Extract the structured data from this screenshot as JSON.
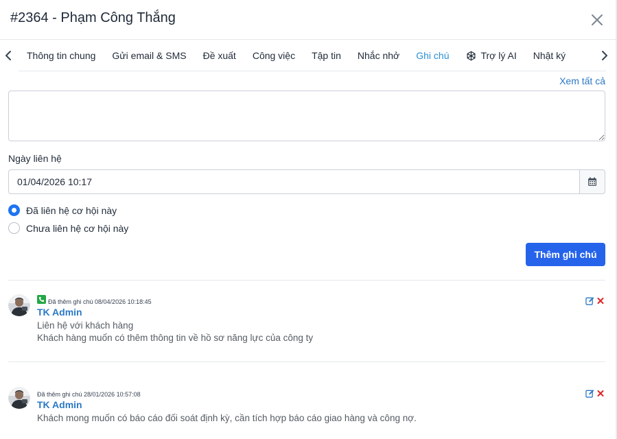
{
  "modal": {
    "title": "#2364 - Phạm Công Thắng"
  },
  "tabs": [
    {
      "label": "Thông tin chung"
    },
    {
      "label": "Gửi email & SMS"
    },
    {
      "label": "Đề xuất"
    },
    {
      "label": "Công việc"
    },
    {
      "label": "Tập tin"
    },
    {
      "label": "Nhắc nhở"
    },
    {
      "label": "Ghi chú",
      "active": true
    },
    {
      "label": "Trợ lý AI",
      "icon": "openai-icon"
    },
    {
      "label": "Nhật ký"
    }
  ],
  "notes_form": {
    "view_all": "Xem tất cả",
    "textarea_value": "",
    "contact_date_label": "Ngày liên hệ",
    "contact_date_value": "01/04/2026 10:17",
    "radio_contacted": "Đã liên hệ cơ hội này",
    "radio_not_contacted": "Chưa liên hệ cơ hội này",
    "selected_radio": "contacted",
    "submit_label": "Thêm ghi chú"
  },
  "notes": [
    {
      "meta": "Đã thêm ghi chú 08/04/2026 10:18:45",
      "author": "TK Admin",
      "contact_icon": "phone-icon",
      "lines": [
        "Liên hệ với khách hàng",
        "Khách hàng muốn có thêm thông tin về hồ sơ năng lực của công ty"
      ]
    },
    {
      "meta": "Đã thêm ghi chú 28/01/2026 10:57:08",
      "author": "TK Admin",
      "lines": [
        "Khách mong muốn có báo cáo đối soát định kỳ, cần tích hợp báo cáo giao hàng và công nợ."
      ]
    }
  ],
  "colors": {
    "accent": "#2b8fd6",
    "primary_button": "#2563eb",
    "delete": "#dc2626",
    "phone_badge": "#22a846"
  }
}
